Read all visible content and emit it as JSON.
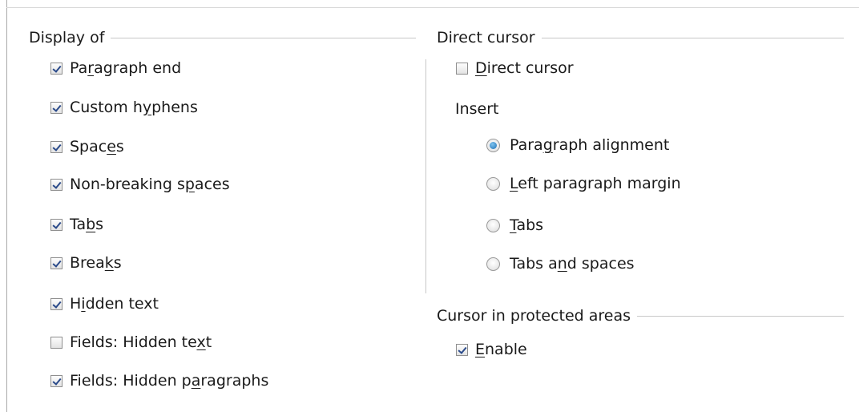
{
  "display_of": {
    "title": "Display of",
    "items": [
      {
        "before": "Pa",
        "key": "r",
        "after": "agraph end",
        "checked": true
      },
      {
        "before": "Custom h",
        "key": "y",
        "after": "phens",
        "checked": true
      },
      {
        "before": "Spac",
        "key": "e",
        "after": "s",
        "checked": true
      },
      {
        "before": "Non-breaking s",
        "key": "p",
        "after": "aces",
        "checked": true
      },
      {
        "before": "Ta",
        "key": "b",
        "after": "s",
        "checked": true
      },
      {
        "before": "Brea",
        "key": "k",
        "after": "s",
        "checked": true
      },
      {
        "before": "H",
        "key": "i",
        "after": "dden text",
        "checked": true
      },
      {
        "before": "Fields: Hidden te",
        "key": "x",
        "after": "t",
        "checked": false
      },
      {
        "before": "Fields: Hidden p",
        "key": "a",
        "after": "ragraphs",
        "checked": true
      }
    ]
  },
  "direct_cursor": {
    "title": "Direct cursor",
    "checkbox": {
      "before": "",
      "key": "D",
      "after": "irect cursor",
      "checked": false
    },
    "insert_label": "Insert",
    "options": [
      {
        "before": "Para",
        "key": "g",
        "after": "raph alignment",
        "selected": true
      },
      {
        "before": "",
        "key": "L",
        "after": "eft paragraph margin",
        "selected": false
      },
      {
        "before": "",
        "key": "T",
        "after": "abs",
        "selected": false
      },
      {
        "before": "Tabs a",
        "key": "n",
        "after": "d spaces",
        "selected": false
      }
    ]
  },
  "protected_areas": {
    "title": "Cursor in protected areas",
    "checkbox": {
      "before": "",
      "key": "E",
      "after": "nable",
      "checked": true
    }
  }
}
